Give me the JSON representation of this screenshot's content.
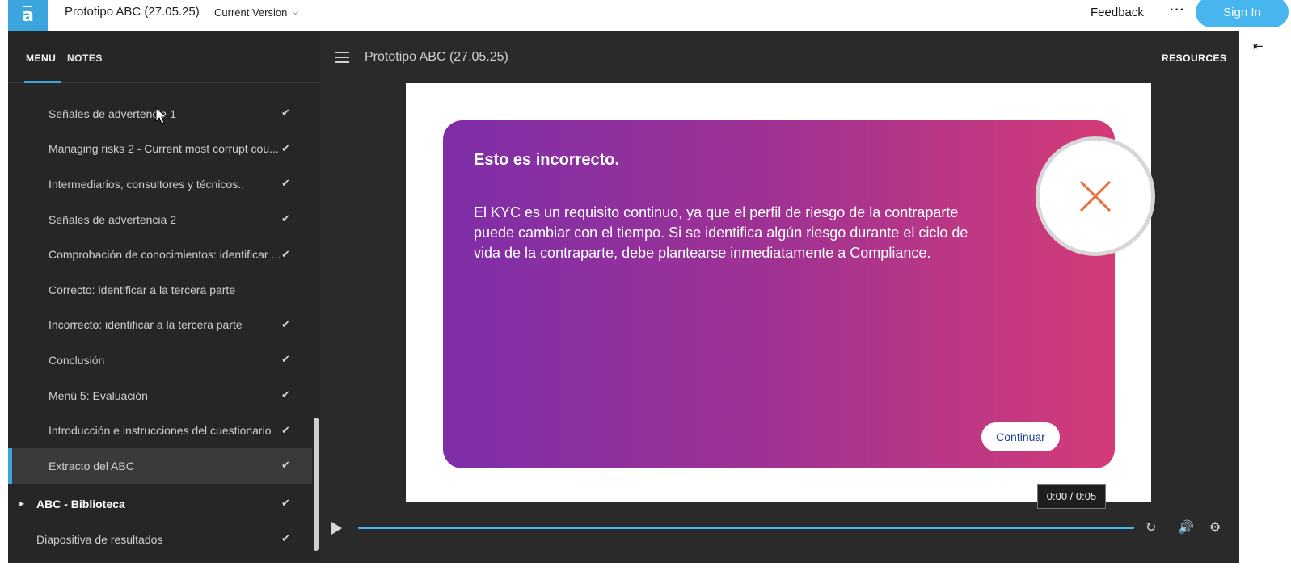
{
  "header": {
    "project_title": "Prototipo ABC (27.05.25)",
    "version_label": "Current Version",
    "feedback_label": "Feedback",
    "more_label": "···",
    "signin_label": "Sign In"
  },
  "sidebar": {
    "tabs": [
      {
        "label": "MENU"
      },
      {
        "label": "NOTES"
      }
    ],
    "items": [
      {
        "label": "Señales de advertencia 1",
        "checked": true
      },
      {
        "label": "Managing risks 2 - Current most corrupt cou...",
        "checked": true
      },
      {
        "label": "Intermediarios, consultores y técnicos..",
        "checked": true
      },
      {
        "label": "Señales de advertencia 2",
        "checked": true
      },
      {
        "label": "Comprobación de conocimientos: identificar ...",
        "checked": true
      },
      {
        "label": "Correcto: identificar a la tercera parte",
        "checked": false
      },
      {
        "label": "Incorrecto: identificar a la tercera parte",
        "checked": true
      },
      {
        "label": "Conclusión",
        "checked": true
      },
      {
        "label": "Menú 5: Evaluación",
        "checked": true
      },
      {
        "label": "Introducción e instrucciones del cuestionario",
        "checked": true
      },
      {
        "label": "Extracto del ABC",
        "checked": true
      }
    ],
    "section": {
      "label": "ABC - Biblioteca",
      "checked": true
    },
    "results": {
      "label": "Diapositiva de resultados",
      "checked": true
    },
    "check_glyph": "✔"
  },
  "player": {
    "title": "Prototipo ABC (27.05.25)",
    "resources_label": "RESOURCES",
    "time_display": "0:00 / 0:05",
    "progress": 1.0
  },
  "slide": {
    "title": "Esto es incorrecto.",
    "body": "El KYC es un requisito continuo, ya que el perfil de riesgo de la contraparte puede cambiar con el tiempo. Si se identifica algún riesgo durante el ciclo de vida de la contraparte, debe plantearse inmediatamente a Compliance.",
    "continue_label": "Continuar"
  },
  "colors": {
    "accent": "#47b6ee",
    "card_gradient_start": "#7e2ea9",
    "card_gradient_end": "#d43b77",
    "x_mark": "#e8703a"
  },
  "icons": [
    "logo-icon",
    "chevron-down-icon",
    "more-icon",
    "hamburger-icon",
    "check-icon",
    "caret-right-icon",
    "close-x-icon",
    "play-icon",
    "replay-icon",
    "volume-icon",
    "settings-icon",
    "collapse-panel-icon",
    "mouse-cursor-icon"
  ]
}
